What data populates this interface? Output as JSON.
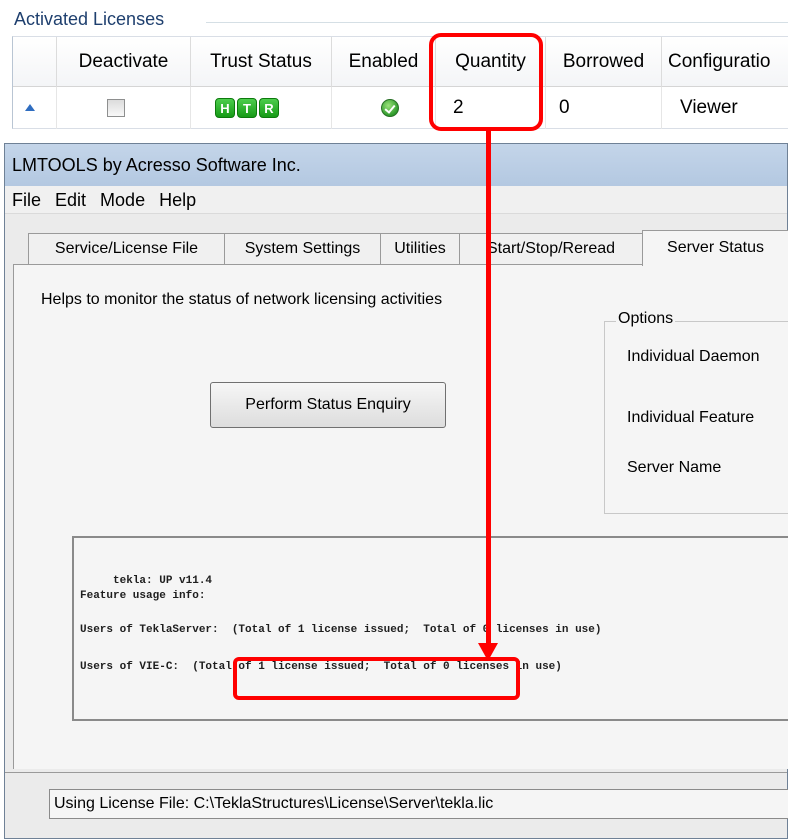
{
  "licenses": {
    "group_title": "Activated Licenses",
    "columns": [
      "Deactivate",
      "Trust Status",
      "Enabled",
      "Quantity",
      "Borrowed",
      "Configuratio"
    ],
    "row": {
      "trust_badges": [
        "H",
        "T",
        "R"
      ],
      "quantity": "2",
      "borrowed": "0",
      "configuration": "Viewer"
    }
  },
  "window": {
    "title": "LMTOOLS by Acresso Software Inc.",
    "menu": [
      "File",
      "Edit",
      "Mode",
      "Help"
    ],
    "tabs": [
      "Service/License File",
      "System Settings",
      "Utilities",
      "Start/Stop/Reread",
      "Server Status"
    ],
    "active_tab": "Server Status",
    "description": "Helps to monitor the status of network licensing activities",
    "status_button": "Perform Status Enquiry",
    "options": {
      "title": "Options",
      "items": [
        "Individual Daemon",
        "Individual Feature",
        "Server Name"
      ]
    },
    "output_lines": [
      "     tekla: UP v11.4",
      "Feature usage info:",
      "Users of TeklaServer:  (Total of 1 license issued;  Total of 0 licenses in use)",
      "Users of VIE-C:  (Total of 1 license issued;  Total of 0 licenses in use)"
    ],
    "statusbar": "Using License File:  C:\\TeklaStructures\\License\\Server\\tekla.lic"
  },
  "colors": {
    "highlight": "#ff0000",
    "title_bar": "#b9cde4",
    "group_title_text": "#1e3f6e",
    "badge_green": "#1ea51e"
  }
}
